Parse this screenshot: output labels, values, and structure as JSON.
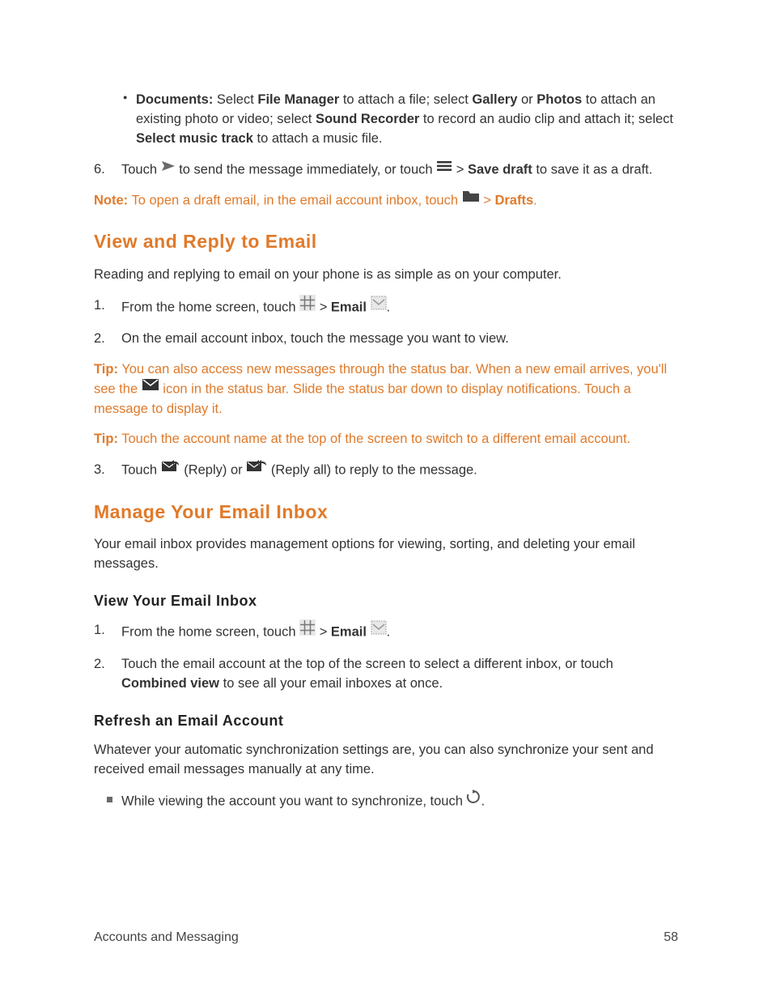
{
  "bullet_documents": {
    "label": "Documents:",
    "t1": " Select ",
    "b1": "File Manager",
    "t2": " to attach a file; select ",
    "b2": "Gallery",
    "t3": " or ",
    "b3": "Photos",
    "t4": " to attach an existing photo or video; select ",
    "b4": "Sound Recorder",
    "t5": " to record an audio clip and attach it; select ",
    "b5": "Select music track",
    "t6": " to attach a music file."
  },
  "step6": {
    "num": "6.",
    "t1": "Touch ",
    "t2": " to send the message immediately, or touch ",
    "t3": " > ",
    "b1": "Save draft",
    "t4": " to save it as a draft."
  },
  "note_draft": {
    "label": "Note:",
    "t1": " To open a draft email, in the email account inbox, touch ",
    "t2": " > ",
    "b1": "Drafts",
    "t3": "."
  },
  "h_view_reply": "View and Reply to Email",
  "p_view_reply": "Reading and replying to email on your phone is as simple as on your computer.",
  "vr_step1": {
    "num": "1.",
    "t1": "From the home screen, touch ",
    "t2": " > ",
    "b1": "Email",
    "t3": " ",
    "t4": "."
  },
  "vr_step2": {
    "num": "2.",
    "t1": "On the email account inbox, touch the message you want to view."
  },
  "tip_status": {
    "label": "Tip:",
    "t1": " You can also access new messages through the status bar. When a new email arrives, you'll see the ",
    "t2": " icon in the status bar. Slide the status bar down to display notifications. Touch a message to display it."
  },
  "tip_account": {
    "label": "Tip:",
    "t1": " Touch the account name at the top of the screen to switch to a different email account."
  },
  "vr_step3": {
    "num": "3.",
    "t1": "Touch ",
    "t2": " (Reply) or ",
    "t3": " (Reply all) to reply to the message."
  },
  "h_manage": "Manage Your Email Inbox",
  "p_manage": "Your email inbox provides management options for viewing, sorting, and deleting your email messages.",
  "h_view_inbox": "View Your Email Inbox",
  "vi_step1": {
    "num": "1.",
    "t1": "From the home screen, touch ",
    "t2": " > ",
    "b1": "Email",
    "t3": " ",
    "t4": "."
  },
  "vi_step2": {
    "num": "2.",
    "t1": "Touch the email account at the top of the screen to select a different inbox, or touch ",
    "b1": "Combined view",
    "t2": " to see all your email inboxes at once."
  },
  "h_refresh": "Refresh an Email Account",
  "p_refresh": "Whatever your automatic synchronization settings are, you can also synchronize your sent and received email messages manually at any time.",
  "refresh_item": {
    "t1": "While viewing the account you want to synchronize, touch ",
    "t2": "."
  },
  "footer": {
    "left": "Accounts and Messaging",
    "right": "58"
  }
}
